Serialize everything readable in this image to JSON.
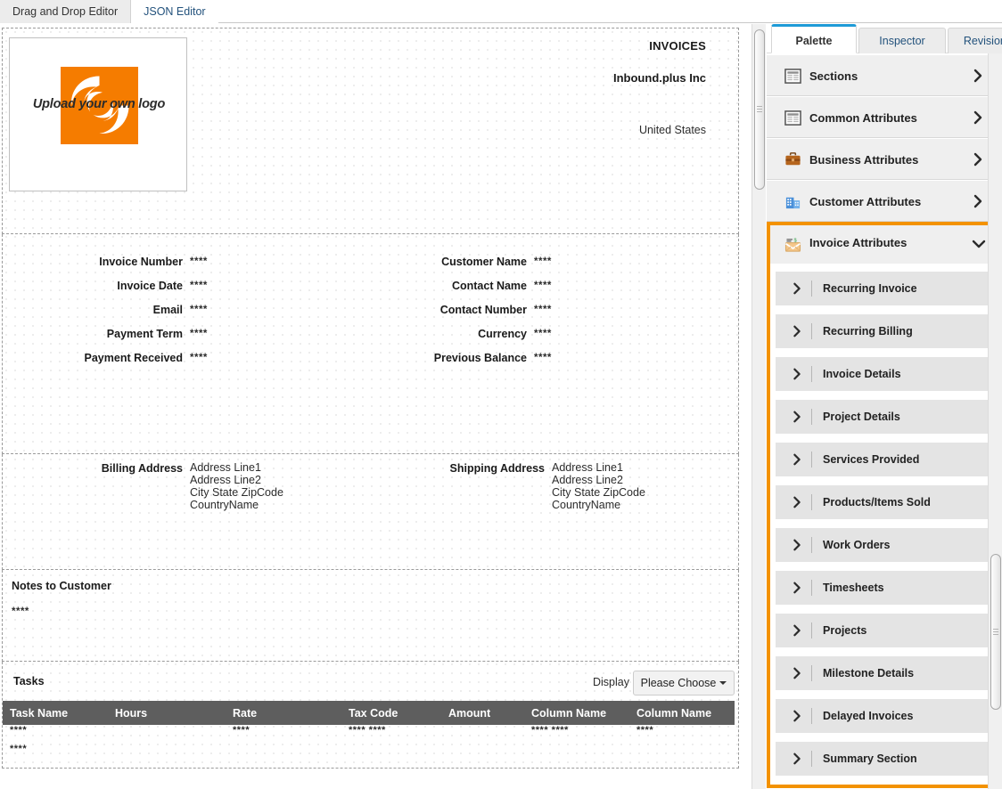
{
  "top_tabs": [
    {
      "label": "Drag and Drop Editor",
      "active": true
    },
    {
      "label": "JSON Editor",
      "active": false
    }
  ],
  "invoice": {
    "logo": {
      "caption": "Upload your own logo",
      "brand_color": "#f57c00"
    },
    "header": {
      "title": "INVOICES",
      "company": "Inbound.plus Inc",
      "country": "United States"
    },
    "fields_left": [
      {
        "label": "Invoice Number",
        "value": "****"
      },
      {
        "label": "Invoice Date",
        "value": "****"
      },
      {
        "label": "Email",
        "value": "****"
      },
      {
        "label": "Payment Term",
        "value": "****"
      },
      {
        "label": "Payment Received",
        "value": "****"
      }
    ],
    "fields_right": [
      {
        "label": "Customer Name",
        "value": "****"
      },
      {
        "label": "Contact Name",
        "value": "****"
      },
      {
        "label": "Contact Number",
        "value": "****"
      },
      {
        "label": "Currency",
        "value": "****"
      },
      {
        "label": "Previous Balance",
        "value": "****"
      }
    ],
    "billing": {
      "label": "Billing Address",
      "line1": "Address Line1",
      "line2": "Address Line2",
      "line3": "City  State  ZipCode",
      "line4": "CountryName"
    },
    "shipping": {
      "label": "Shipping Address",
      "line1": "Address Line1",
      "line2": "Address Line2",
      "line3": "City  State  ZipCode",
      "line4": "CountryName"
    },
    "notes": {
      "title": "Notes to Customer",
      "value": "****"
    },
    "tasks": {
      "title": "Tasks",
      "display_label": "Display",
      "display_value": "Please Choose",
      "columns": [
        "Task Name",
        "Hours",
        "Rate",
        "Tax Code",
        "Amount",
        "Column Name",
        "Column Name"
      ],
      "rows": [
        [
          "****",
          "",
          "****",
          "****  ****",
          "",
          "****  ****",
          "****"
        ],
        [
          "****",
          "",
          "",
          "",
          "",
          "",
          ""
        ]
      ]
    }
  },
  "panel": {
    "tabs": [
      {
        "label": "Palette",
        "active": true
      },
      {
        "label": "Inspector",
        "active": false
      },
      {
        "label": "Revisions",
        "active": false
      }
    ],
    "highlight_color": "#f39200",
    "groups": [
      {
        "label": "Sections",
        "icon": "grid-icon",
        "expanded": false,
        "highlighted": false
      },
      {
        "label": "Common Attributes",
        "icon": "grid-icon",
        "expanded": false,
        "highlighted": false
      },
      {
        "label": "Business Attributes",
        "icon": "briefcase-icon",
        "expanded": false,
        "highlighted": false
      },
      {
        "label": "Customer Attributes",
        "icon": "building-icon",
        "expanded": false,
        "highlighted": false
      },
      {
        "label": "Invoice Attributes",
        "icon": "envelope-icon",
        "expanded": true,
        "highlighted": true
      }
    ],
    "sub_items": [
      {
        "label": "Recurring Invoice"
      },
      {
        "label": "Recurring Billing"
      },
      {
        "label": "Invoice Details"
      },
      {
        "label": "Project Details"
      },
      {
        "label": "Services Provided"
      },
      {
        "label": "Products/Items Sold"
      },
      {
        "label": "Work Orders"
      },
      {
        "label": "Timesheets"
      },
      {
        "label": "Projects"
      },
      {
        "label": "Milestone Details"
      },
      {
        "label": "Delayed Invoices"
      },
      {
        "label": "Summary Section"
      }
    ]
  }
}
